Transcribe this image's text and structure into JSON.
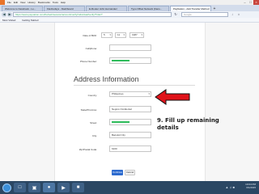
{
  "browser": {
    "menu": [
      "File",
      "Edit",
      "View",
      "History",
      "Bookmarks",
      "Tools",
      "Help"
    ],
    "tabs": [
      {
        "label": "Welcome to Facebook - Lo..."
      },
      {
        "label": "Flexbudsys - Dashboard"
      },
      {
        "label": "E-Router John Hernandez"
      },
      {
        "label": "Typo Offset Network (Fans..."
      },
      {
        "label": "PayNation - Add Transfer Method",
        "active": true
      }
    ],
    "url": "https://www.paynation.com/bs/web/session/account/verify/individual/verify/?/ide/?",
    "search_placeholder": "Google",
    "bookmarks": [
      "Most Visited",
      "Getting Started"
    ]
  },
  "form": {
    "dob_label": "Date of Birth:",
    "dob_month": "5",
    "dob_day": "11",
    "dob_year": "1987",
    "cellphone_label": "Cellphone:",
    "cellphone_value": "",
    "phone_label": "Phone Number:",
    "section_title": "Address Information",
    "country_label": "Country:",
    "country_value": "Philippines",
    "state_label": "State/Province:",
    "state_value": "Negros Occidental",
    "street_label": "Street:",
    "city_label": "City:",
    "city_value": "Bacolod City",
    "zip_label": "Zip/Postal Code:",
    "zip_value": "6100",
    "submit_label": "Continue",
    "cancel_label": "Cancel"
  },
  "annotation": {
    "text": "9. Fill up remaining details",
    "arrow_color": "#e0131a"
  },
  "taskbar": {
    "time": "10:04 PM",
    "date": "6/1/2015"
  },
  "colors": {
    "primary_button": "#2d6bcf",
    "redaction": "#2ebc5b",
    "taskbar": "#2b4763"
  }
}
